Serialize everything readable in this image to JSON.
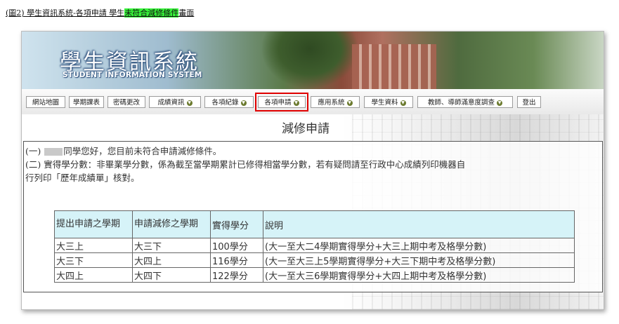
{
  "caption": {
    "prefix": "(圖2) 學生資訊系統-各項申請 學生",
    "highlight": "未符合減修條件",
    "suffix": "畫面"
  },
  "logo": {
    "zh": "學生資訊系統",
    "en": "STUDENT INFORMATION SYSTEM"
  },
  "nav": [
    {
      "label": "網站地圖",
      "dropdown": false
    },
    {
      "label": "學期課表",
      "dropdown": false
    },
    {
      "label": "密碼更改",
      "dropdown": false
    },
    {
      "label": "成績資訊",
      "dropdown": true
    },
    {
      "label": "各項紀錄",
      "dropdown": true
    },
    {
      "label": "各項申請",
      "dropdown": true
    },
    {
      "label": "應用系統",
      "dropdown": true
    },
    {
      "label": "學生資料",
      "dropdown": true
    },
    {
      "label": "教師、導師滿意度調查",
      "dropdown": true
    },
    {
      "label": "登出",
      "dropdown": false
    }
  ],
  "page_title": "減修申請",
  "notice": {
    "line1_prefix": "(一)",
    "line1_suffix": "同學您好，您目前未符合申請減修條件。",
    "line2": "(二) 實得學分數：非畢業學分數，係為截至當學期累計已修得相當學分數，若有疑問請至行政中心成績列印機器自",
    "line3": "行列印「歷年成績單」核對。"
  },
  "table": {
    "headers": [
      "提出申請之學期",
      "申請減修之學期",
      "實得學分",
      "說明"
    ],
    "rows": [
      [
        "大三上",
        "大三下",
        "100學分",
        "(大一至大二4學期實得學分+大三上期中考及格學分數)"
      ],
      [
        "大三下",
        "大四上",
        "116學分",
        "(大一至大三上5學期實得學分+大三下期中考及格學分數)"
      ],
      [
        "大四上",
        "大四下",
        "122學分",
        "(大一至大三6學期實得學分+大四上期中考及格學分數)"
      ]
    ]
  },
  "colors": {
    "highlight_box": "#e00000",
    "caption_highlight": "#37f23a",
    "table_header_bg": "#d6f3f8"
  }
}
